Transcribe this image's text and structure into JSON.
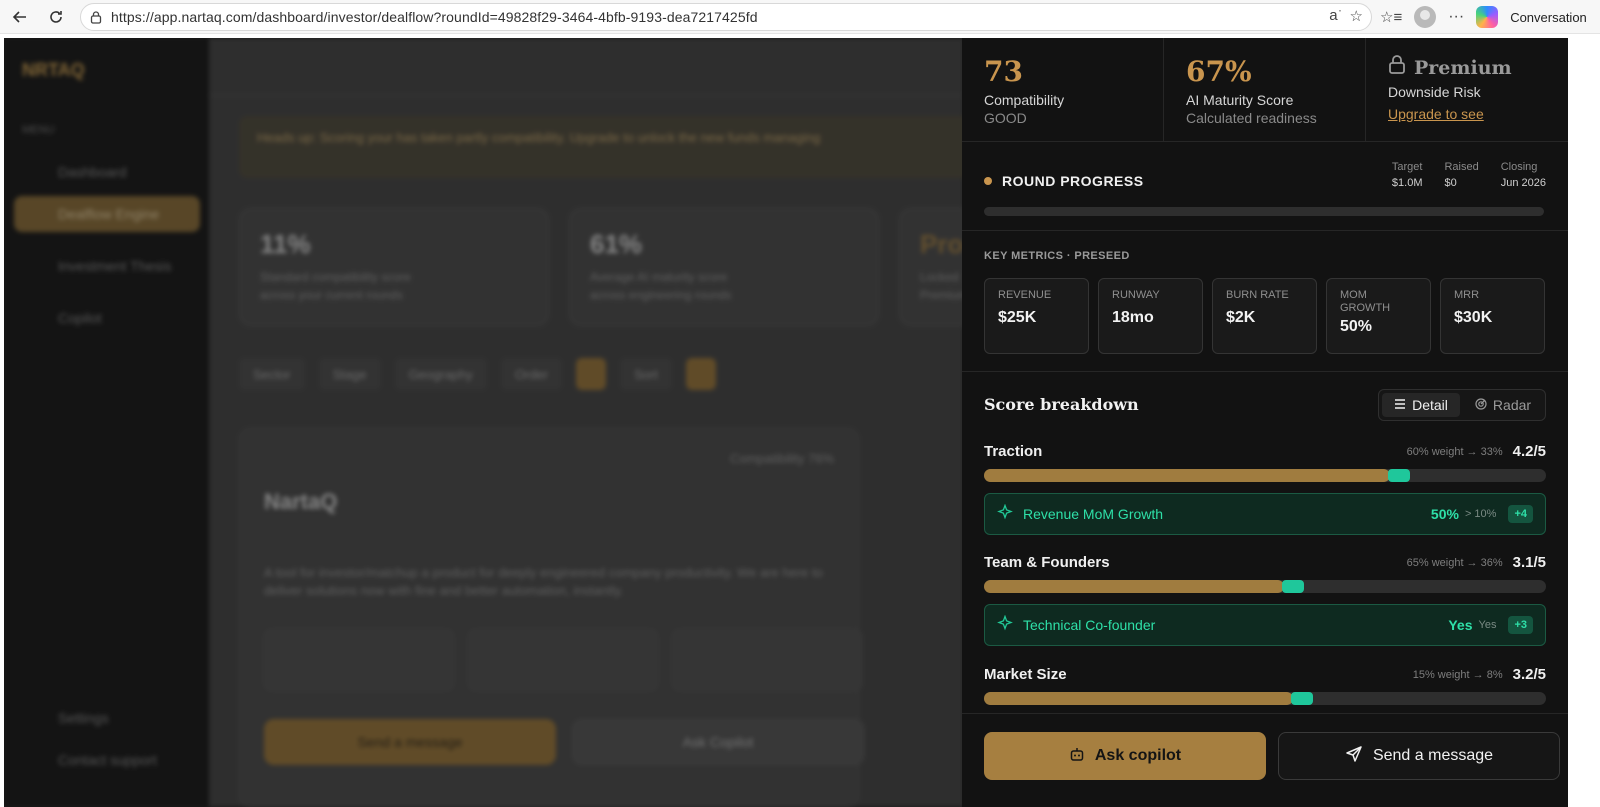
{
  "browser": {
    "url": "https://app.nartaq.com/dashboard/investor/dealflow?roundId=49828f29-3464-4bfb-9193-dea7217425fd",
    "profile_label": "Conversation",
    "icons": [
      "back-icon",
      "refresh-icon",
      "lock-icon",
      "translate-icon",
      "star-icon",
      "favorites-icon",
      "profile-icon",
      "more-icon",
      "copilot-icon"
    ]
  },
  "background_app": {
    "logo": "NRTAQ",
    "menu_label": "MENU",
    "sidebar_items": [
      {
        "label": "Dashboard",
        "active": false
      },
      {
        "label": "Dealflow Engine",
        "active": true
      },
      {
        "label": "Investment Thesis",
        "active": false
      },
      {
        "label": "Copilot",
        "active": false
      },
      {
        "label": "Settings",
        "active": false
      },
      {
        "label": "Contact support",
        "active": false
      }
    ],
    "banner_text": "Heads up: Scoring your has taken partly compatibility. Upgrade to unlock the new funds managing",
    "kpis": [
      {
        "value": "11%",
        "label": "Standard compatibility score",
        "sub": "across your current rounds"
      },
      {
        "value": "61%",
        "label": "Average AI maturity score",
        "sub": "across engineering rounds"
      },
      {
        "value": "Pro",
        "label": "Locked",
        "sub": "Premium"
      }
    ],
    "filters": [
      "Sector",
      "Stage",
      "Geography",
      "Order",
      "Sort"
    ],
    "deal": {
      "name": "NartaQ",
      "compatibility": "Compatibility 76%",
      "description": "A tool for investor/matchup a product for deeply engineered company productivity. We are here to deliver solutions now with fine and better automation, instantly.",
      "btn_primary": "Send a message",
      "btn_secondary": "Ask Copilot"
    }
  },
  "panel": {
    "top_cards": [
      {
        "value": "73",
        "label": "Compatibility",
        "sub": "GOOD"
      },
      {
        "value": "67%",
        "label": "AI Maturity Score",
        "sub": "Calculated readiness"
      },
      {
        "premium_label": "Premium",
        "label": "Downside Risk",
        "link": "Upgrade to see"
      }
    ],
    "round": {
      "title": "ROUND PROGRESS",
      "meta": [
        {
          "k": "Target",
          "v": "$1.0M"
        },
        {
          "k": "Raised",
          "v": "$0"
        },
        {
          "k": "Closing",
          "v": "Jun 2026"
        }
      ],
      "progress": 0
    },
    "metrics": {
      "header": "KEY METRICS · PRESEED",
      "items": [
        {
          "k": "REVENUE",
          "v": "$25K"
        },
        {
          "k": "RUNWAY",
          "v": "18mo"
        },
        {
          "k": "BURN RATE",
          "v": "$2K"
        },
        {
          "k": "MOM GROWTH",
          "v": "50%"
        },
        {
          "k": "MRR",
          "v": "$30K"
        }
      ]
    },
    "scores": {
      "header": "Score breakdown",
      "toggle": [
        "Detail",
        "Radar"
      ],
      "criteria": [
        {
          "name": "Traction",
          "weight": "60% weight → 33%",
          "score": "4.2/5",
          "value": 4.2
        },
        {
          "name": "Team & Founders",
          "weight": "65% weight → 36%",
          "score": "3.1/5",
          "value": 3.1
        },
        {
          "name": "Market Size",
          "weight": "15% weight → 8%",
          "score": "3.2/5",
          "value": 3.2
        }
      ],
      "signals": [
        {
          "name": "Revenue MoM Growth",
          "value": "50%",
          "threshold": "> 10%",
          "points": "+4"
        },
        {
          "name": "Technical Co-founder",
          "value": "Yes",
          "threshold": "Yes",
          "points": "+3"
        }
      ]
    },
    "footer": {
      "ask_label": "Ask copilot",
      "send_label": "Send a message"
    },
    "colors": {
      "gold": "#c9954e",
      "teal": "#1fc79b",
      "panel_bg": "#121212"
    }
  }
}
